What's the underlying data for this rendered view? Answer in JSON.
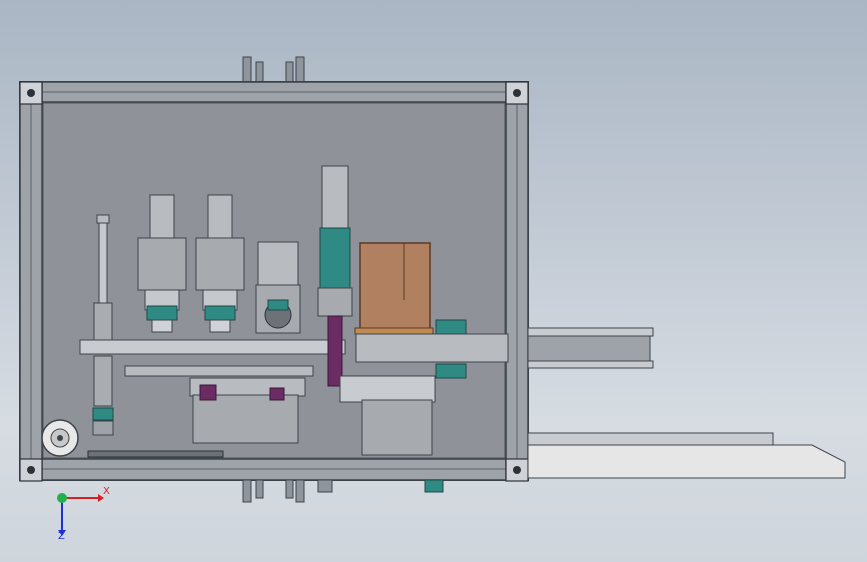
{
  "viewport": {
    "background_top": "#aab6c4",
    "background_bottom": "#d6dce2"
  },
  "colors": {
    "frame_dark": "#3d434a",
    "frame_mid": "#7a8088",
    "panel_fill": "#8c9096",
    "module_grey": "#a7abb0",
    "teal": "#2e8a82",
    "purple": "#6b2c63",
    "cardboard": "#b08060",
    "conveyor_light": "#e6e6e6"
  },
  "triad": {
    "x_label": "X",
    "z_label": "Z",
    "x_color": "#d81f1f",
    "y_color": "#23b04a",
    "z_color": "#1f2fd8"
  },
  "parts": {
    "frame": "aluminum-frame",
    "grippers": [
      "gripper-left",
      "gripper-right"
    ],
    "cylinder": "air-cylinder",
    "camera": "inspection-module",
    "lift": "vertical-lift-axis",
    "box": "cardboard-box",
    "conveyor": "output-conveyor",
    "tray": "feed-tray",
    "roll": "tape-roll"
  }
}
